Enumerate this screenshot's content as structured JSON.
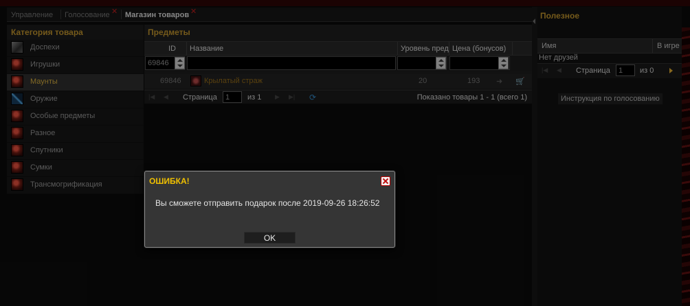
{
  "tabs": [
    {
      "label": "Управление",
      "closable": false,
      "active": false
    },
    {
      "label": "Голосование",
      "closable": true,
      "active": false
    },
    {
      "label": "Магазин товаров",
      "closable": true,
      "active": true
    }
  ],
  "categories": {
    "title": "Категория товара",
    "items": [
      {
        "label": "Доспехи",
        "icon": "armor-icon",
        "selected": false
      },
      {
        "label": "Игрушки",
        "icon": "toy-icon",
        "selected": false
      },
      {
        "label": "Маунты",
        "icon": "mount-icon",
        "selected": true
      },
      {
        "label": "Оружие",
        "icon": "sword-icon",
        "selected": false
      },
      {
        "label": "Особые предметы",
        "icon": "special-item-icon",
        "selected": false
      },
      {
        "label": "Разное",
        "icon": "misc-icon",
        "selected": false
      },
      {
        "label": "Спутники",
        "icon": "companion-icon",
        "selected": false
      },
      {
        "label": "Сумки",
        "icon": "bag-icon",
        "selected": false
      },
      {
        "label": "Трансмогрификация",
        "icon": "transmog-icon",
        "selected": false
      }
    ]
  },
  "items": {
    "title": "Предметы",
    "columns": {
      "id": "ID",
      "name": "Название",
      "level": "Уровень пред",
      "price": "Цена (бонусов)"
    },
    "filter": {
      "id_value": "69846",
      "name_value": "",
      "level_value": "",
      "price_value": ""
    },
    "rows": [
      {
        "id": "69846",
        "name": "Крылатый страж",
        "level": "20",
        "price": "193"
      }
    ],
    "pager": {
      "page_label": "Страница",
      "page_value": "1",
      "of_label": "из 1",
      "summary": "Показано товары 1 - 1 (всего 1)"
    }
  },
  "useful": {
    "title": "Полезное",
    "columns": {
      "name": "Имя",
      "in_game": "В игре"
    },
    "empty_text": "Нет друзей",
    "pager": {
      "page_label": "Страница",
      "page_value": "1",
      "of_label": "из 0"
    },
    "vote_instructions": "Инструкция по голосованию"
  },
  "dialog": {
    "title": "ОШИБКА!",
    "message": "Вы сможете отправить подарок после 2019-09-26 18:26:52",
    "ok_label": "OK"
  },
  "colors": {
    "accent": "#b48a2a",
    "dialog_title": "#f0c000",
    "item_name": "#8a6418"
  }
}
